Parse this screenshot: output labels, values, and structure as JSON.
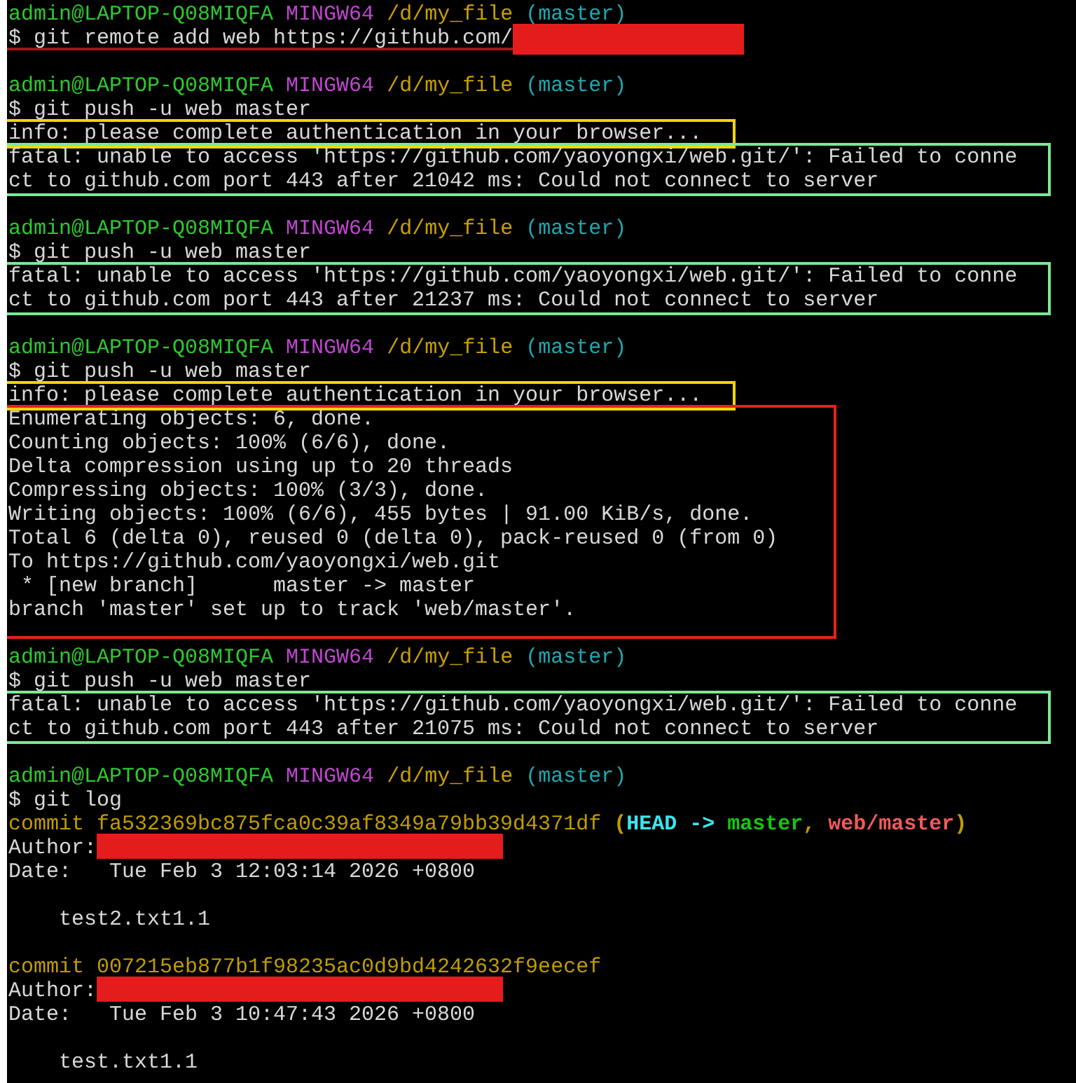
{
  "terminal": {
    "entries": [
      {
        "kind": "prompt",
        "user": "admin@LAPTOP-Q08MIQFA",
        "system": "MINGW64",
        "path": "/d/my_file",
        "branch": "(master)"
      },
      {
        "kind": "command",
        "text": "$ git remote add web https://github.com/",
        "redacted": true,
        "underlined": true
      },
      {
        "kind": "blank"
      },
      {
        "kind": "prompt",
        "user": "admin@LAPTOP-Q08MIQFA",
        "system": "MINGW64",
        "path": "/d/my_file",
        "branch": "(master)"
      },
      {
        "kind": "command",
        "text": "$ git push -u web master",
        "redacted": false,
        "underlined": true
      },
      {
        "kind": "frame",
        "color": "#f2d600",
        "lines": [
          "info: please complete authentication in your browser..."
        ]
      },
      {
        "kind": "frame",
        "color": "#7de895",
        "lines": [
          "fatal: unable to access 'https://github.com/yaoyongxi/web.git/': Failed to conne",
          "ct to github.com port 443 after 21042 ms: Could not connect to server"
        ]
      },
      {
        "kind": "blank"
      },
      {
        "kind": "prompt",
        "user": "admin@LAPTOP-Q08MIQFA",
        "system": "MINGW64",
        "path": "/d/my_file",
        "branch": "(master)"
      },
      {
        "kind": "command",
        "text": "$ git push -u web master",
        "redacted": false,
        "underlined": false
      },
      {
        "kind": "frame",
        "color": "#7de895",
        "lines": [
          "fatal: unable to access 'https://github.com/yaoyongxi/web.git/': Failed to conne",
          "ct to github.com port 443 after 21237 ms: Could not connect to server"
        ]
      },
      {
        "kind": "blank"
      },
      {
        "kind": "prompt",
        "user": "admin@LAPTOP-Q08MIQFA",
        "system": "MINGW64",
        "path": "/d/my_file",
        "branch": "(master)"
      },
      {
        "kind": "command",
        "text": "$ git push -u web master",
        "redacted": false,
        "underlined": false
      },
      {
        "kind": "frame",
        "color": "#f2d600",
        "lines": [
          "info: please complete authentication in your browser..."
        ]
      },
      {
        "kind": "frame",
        "color": "#e8201c",
        "lines": [
          "Enumerating objects: 6, done.",
          "Counting objects: 100% (6/6), done.",
          "Delta compression using up to 20 threads",
          "Compressing objects: 100% (3/3), done.",
          "Writing objects: 100% (6/6), 455 bytes | 91.00 KiB/s, done.",
          "Total 6 (delta 0), reused 0 (delta 0), pack-reused 0 (from 0)",
          "To https://github.com/yaoyongxi/web.git",
          " * [new branch]      master -> master",
          "branch 'master' set up to track 'web/master'."
        ]
      },
      {
        "kind": "blank"
      },
      {
        "kind": "prompt",
        "user": "admin@LAPTOP-Q08MIQFA",
        "system": "MINGW64",
        "path": "/d/my_file",
        "branch": "(master)"
      },
      {
        "kind": "command",
        "text": "$ git push -u web master",
        "redacted": false,
        "underlined": false
      },
      {
        "kind": "frame",
        "color": "#7de895",
        "lines": [
          "fatal: unable to access 'https://github.com/yaoyongxi/web.git/': Failed to conne",
          "ct to github.com port 443 after 21075 ms: Could not connect to server"
        ]
      },
      {
        "kind": "blank"
      },
      {
        "kind": "prompt",
        "user": "admin@LAPTOP-Q08MIQFA",
        "system": "MINGW64",
        "path": "/d/my_file",
        "branch": "(master)"
      },
      {
        "kind": "command",
        "text": "$ git log",
        "redacted": false,
        "underlined": false
      },
      {
        "kind": "commit",
        "text": "commit fa532369bc875fca0c39af8349a79bb39d4371df",
        "refs": [
          {
            "text": " (",
            "color": "#c19c00"
          },
          {
            "text": "HEAD -> ",
            "color": "#3ae6ee"
          },
          {
            "text": "master",
            "color": "#16c60c"
          },
          {
            "text": ", ",
            "color": "#c19c00"
          },
          {
            "text": "web/master",
            "color": "#f05a5a"
          },
          {
            "text": ")",
            "color": "#c19c00"
          }
        ]
      },
      {
        "kind": "author",
        "text": "Author:",
        "redacted": true
      },
      {
        "kind": "text",
        "text": "Date:   Tue Feb 3 12:03:14 2026 +0800"
      },
      {
        "kind": "blank"
      },
      {
        "kind": "message",
        "text": "test2.txt1.1"
      },
      {
        "kind": "blank"
      },
      {
        "kind": "commit",
        "text": "commit 007215eb877b1f98235ac0d9bd4242632f9eecef"
      },
      {
        "kind": "author",
        "text": "Author:",
        "redacted": true
      },
      {
        "kind": "text",
        "text": "Date:   Tue Feb 3 10:47:43 2026 +0800"
      },
      {
        "kind": "blank"
      },
      {
        "kind": "message",
        "text": "test.txt1.1"
      }
    ]
  }
}
